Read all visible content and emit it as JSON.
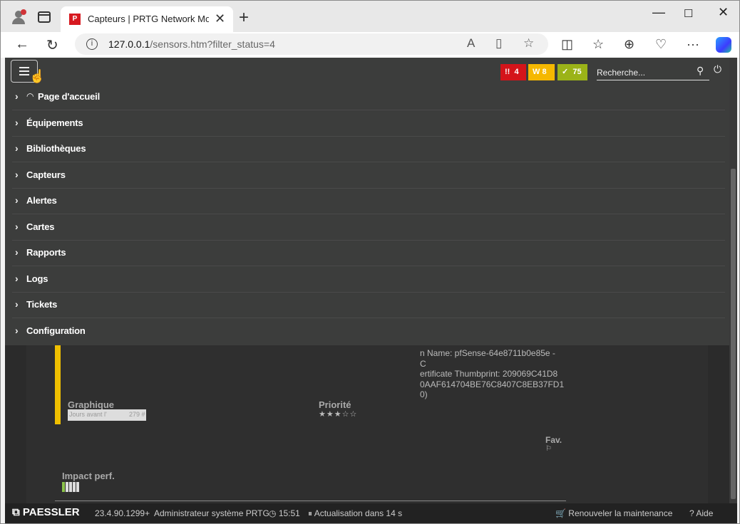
{
  "browser": {
    "tab_title": "Capteurs | PRTG Network Monito",
    "tab_favicon": "P",
    "url_host": "127.0.0.1",
    "url_path": "/sensors.htm?filter_status=4",
    "icons": [
      "profile-icon",
      "tab-actions-icon",
      "close-icon",
      "new-tab-icon",
      "minimize-icon",
      "maximize-icon",
      "close-window-icon",
      "back-icon",
      "reload-icon",
      "info-icon",
      "read-aloud-icon",
      "immersive-reader-icon",
      "favorite-icon",
      "split-screen-icon",
      "favorites-icon",
      "collections-icon",
      "health-icon",
      "more-icon",
      "copilot-icon"
    ]
  },
  "prtg": {
    "badges": {
      "red": {
        "icon": "!!",
        "count": "4",
        "color": "#d4141a"
      },
      "yellow": {
        "icon": "W",
        "count": "8",
        "color": "#f5b800"
      },
      "green": {
        "icon": "✓",
        "count": "75",
        "color": "#9bb318"
      }
    },
    "search_placeholder": "Recherche...",
    "menu": [
      "Page d'accueil",
      "Équipements",
      "Bibliothèques",
      "Capteurs",
      "Alertes",
      "Cartes",
      "Rapports",
      "Logs",
      "Tickets",
      "Configuration"
    ],
    "content": {
      "cert_lines": [
        "n Name: pfSense-64e8711b0e85e - C",
        "ertificate Thumbprint: 209069C41D8",
        "0AAF614704BE76C8407C8EB37FD1",
        "0)"
      ],
      "graph_label": "Graphique",
      "mini_chart_left": "Jours avant l'",
      "mini_chart_right": "279 #",
      "priority_label": "Priorité",
      "priority_stars": "★★★☆☆",
      "priority_value": 3,
      "fav_label": "Fav.",
      "perf_label": "Impact perf."
    },
    "footer": {
      "brand": "PAESSLER",
      "version": "23.4.90.1299+",
      "user": "Administrateur système PRTG",
      "time": "15:51",
      "refresh": "Actualisation dans 14 s",
      "renew": "Renouveler la maintenance",
      "help": "Aide"
    }
  }
}
